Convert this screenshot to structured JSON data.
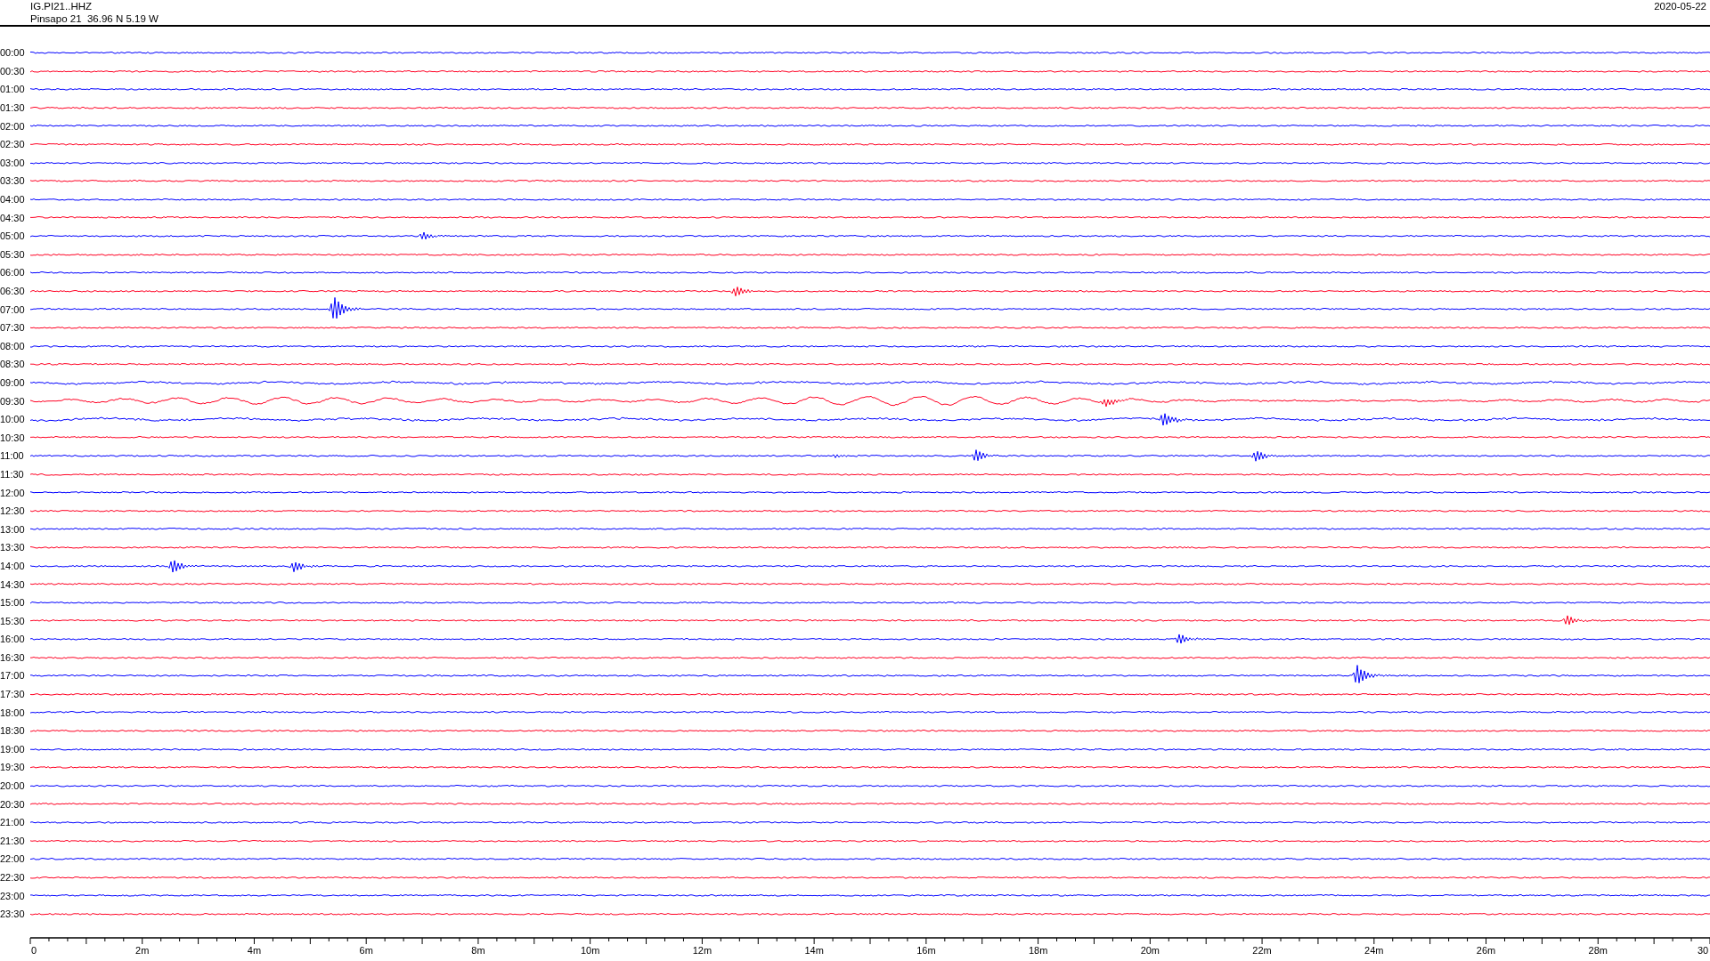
{
  "header": {
    "channel": "IG.PI21..HHZ",
    "station": "Pinsapo 21  36.96 N 5.19 W",
    "date": "2020-05-22"
  },
  "rows": [
    {
      "time": "00:00",
      "color": "#0000ff"
    },
    {
      "time": "00:30",
      "color": "#ff0022"
    },
    {
      "time": "01:00",
      "color": "#0000ff"
    },
    {
      "time": "01:30",
      "color": "#ff0022"
    },
    {
      "time": "02:00",
      "color": "#0000ff"
    },
    {
      "time": "02:30",
      "color": "#ff0022"
    },
    {
      "time": "03:00",
      "color": "#0000ff"
    },
    {
      "time": "03:30",
      "color": "#ff0022"
    },
    {
      "time": "04:00",
      "color": "#0000ff"
    },
    {
      "time": "04:30",
      "color": "#ff0022"
    },
    {
      "time": "05:00",
      "color": "#0000ff"
    },
    {
      "time": "05:30",
      "color": "#ff0022"
    },
    {
      "time": "06:00",
      "color": "#0000ff"
    },
    {
      "time": "06:30",
      "color": "#ff0022"
    },
    {
      "time": "07:00",
      "color": "#0000ff"
    },
    {
      "time": "07:30",
      "color": "#ff0022"
    },
    {
      "time": "08:00",
      "color": "#0000ff"
    },
    {
      "time": "08:30",
      "color": "#ff0022"
    },
    {
      "time": "09:00",
      "color": "#0000ff"
    },
    {
      "time": "09:30",
      "color": "#ff0022"
    },
    {
      "time": "10:00",
      "color": "#0000ff"
    },
    {
      "time": "10:30",
      "color": "#ff0022"
    },
    {
      "time": "11:00",
      "color": "#0000ff"
    },
    {
      "time": "11:30",
      "color": "#ff0022"
    },
    {
      "time": "12:00",
      "color": "#0000ff"
    },
    {
      "time": "12:30",
      "color": "#ff0022"
    },
    {
      "time": "13:00",
      "color": "#0000ff"
    },
    {
      "time": "13:30",
      "color": "#ff0022"
    },
    {
      "time": "14:00",
      "color": "#0000ff"
    },
    {
      "time": "14:30",
      "color": "#ff0022"
    },
    {
      "time": "15:00",
      "color": "#0000ff"
    },
    {
      "time": "15:30",
      "color": "#ff0022"
    },
    {
      "time": "16:00",
      "color": "#0000ff"
    },
    {
      "time": "16:30",
      "color": "#ff0022"
    },
    {
      "time": "17:00",
      "color": "#0000ff"
    },
    {
      "time": "17:30",
      "color": "#ff0022"
    },
    {
      "time": "18:00",
      "color": "#0000ff"
    },
    {
      "time": "18:30",
      "color": "#ff0022"
    },
    {
      "time": "19:00",
      "color": "#0000ff"
    },
    {
      "time": "19:30",
      "color": "#ff0022"
    },
    {
      "time": "20:00",
      "color": "#0000ff"
    },
    {
      "time": "20:30",
      "color": "#ff0022"
    },
    {
      "time": "21:00",
      "color": "#0000ff"
    },
    {
      "time": "21:30",
      "color": "#ff0022"
    },
    {
      "time": "22:00",
      "color": "#0000ff"
    },
    {
      "time": "22:30",
      "color": "#ff0022"
    },
    {
      "time": "23:00",
      "color": "#0000ff"
    },
    {
      "time": "23:30",
      "color": "#ff0022"
    }
  ],
  "time_axis": {
    "labels": [
      "0",
      "2m",
      "4m",
      "6m",
      "8m",
      "10m",
      "12m",
      "14m",
      "16m",
      "18m",
      "20m",
      "22m",
      "24m",
      "26m",
      "28m",
      "30"
    ]
  }
}
